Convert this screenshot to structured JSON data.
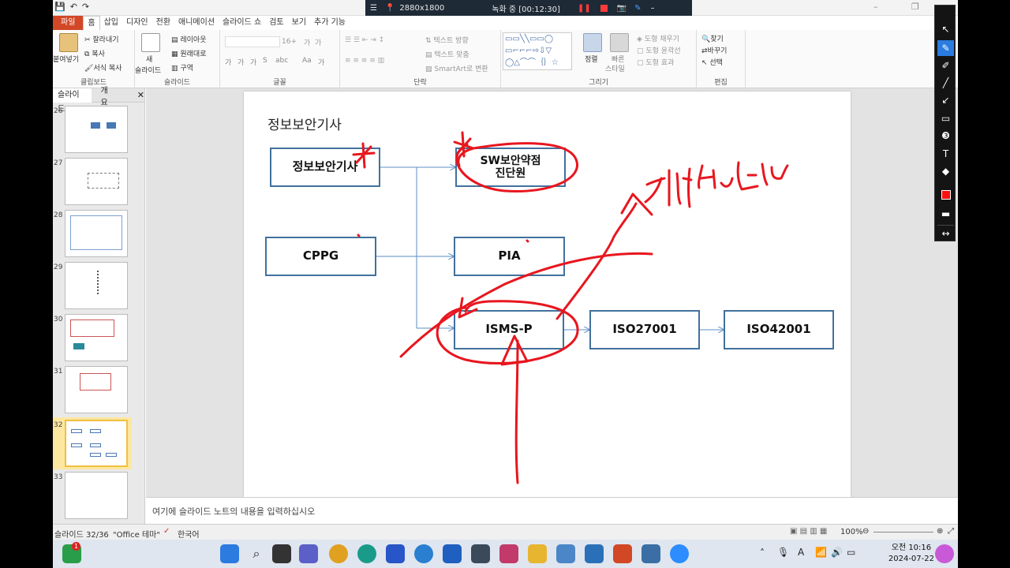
{
  "titlebar": {
    "qat": [
      "💾",
      "↶",
      "↷"
    ],
    "recording": {
      "resolution": "2880x1800",
      "status": "녹화 중 [00:12:30]"
    }
  },
  "tabs": [
    "파일",
    "홈",
    "삽입",
    "디자인",
    "전환",
    "애니메이션",
    "슬라이드 쇼",
    "검토",
    "보기",
    "추가 기능"
  ],
  "ribbon": {
    "clipboard": {
      "paste": "붙여넣기",
      "cut": "잘라내기",
      "copy": "복사",
      "format_painter": "서식 복사",
      "label": "클립보드"
    },
    "slides": {
      "new_slide_top": "새",
      "new_slide_bottom": "슬라이드",
      "layout": "레이아웃",
      "reset": "원래대로",
      "section": "구역",
      "label": "슬라이드"
    },
    "font": {
      "size": "16+",
      "grow": "가",
      "shrink": "가",
      "bold": "가",
      "italic": "가",
      "underline": "가",
      "strike": "S",
      "spacing": "abc",
      "case": "Aa",
      "color": "가",
      "label": "글꼴"
    },
    "paragraph": {
      "text_direction": "텍스트 방향",
      "align_text": "텍스트 맞춤",
      "smartart": "SmartArt로 변환",
      "label": "단락"
    },
    "drawing": {
      "arrange": "정렬",
      "quick_styles_top": "빠른",
      "quick_styles_bottom": "스타일",
      "shape_fill": "도형 채우기",
      "shape_outline": "도형 윤곽선",
      "shape_effects": "도형 효과",
      "label": "그리기"
    },
    "editing": {
      "find": "찾기",
      "replace": "바꾸기",
      "select": "선택",
      "label": "편집"
    }
  },
  "pane": {
    "tab_slides": "슬라이드",
    "tab_outline": "개요",
    "close": "✕",
    "thumbnails": [
      "26",
      "27",
      "28",
      "29",
      "30",
      "31",
      "32",
      "33"
    ],
    "selected": "32"
  },
  "slide": {
    "title": "정보보안기사",
    "boxes": {
      "engineer": "정보보안기사",
      "sw": "SW보안약점\n진단원",
      "cppg": "CPPG",
      "pia": "PIA",
      "isms": "ISMS-P",
      "iso27001": "ISO27001",
      "iso42001": "ISO42001"
    },
    "ink_color": "#e8161e"
  },
  "notes": {
    "placeholder": "여기에 슬라이드 노트의 내용을 입력하십시오"
  },
  "status": {
    "slide_pos": "슬라이드 32/36",
    "theme": "\"Office 테마\"",
    "language": "한국어",
    "zoom": "100%"
  },
  "taskbar": {
    "time": "오전 10:16",
    "date": "2024-07-22",
    "notification_badge": "1"
  }
}
